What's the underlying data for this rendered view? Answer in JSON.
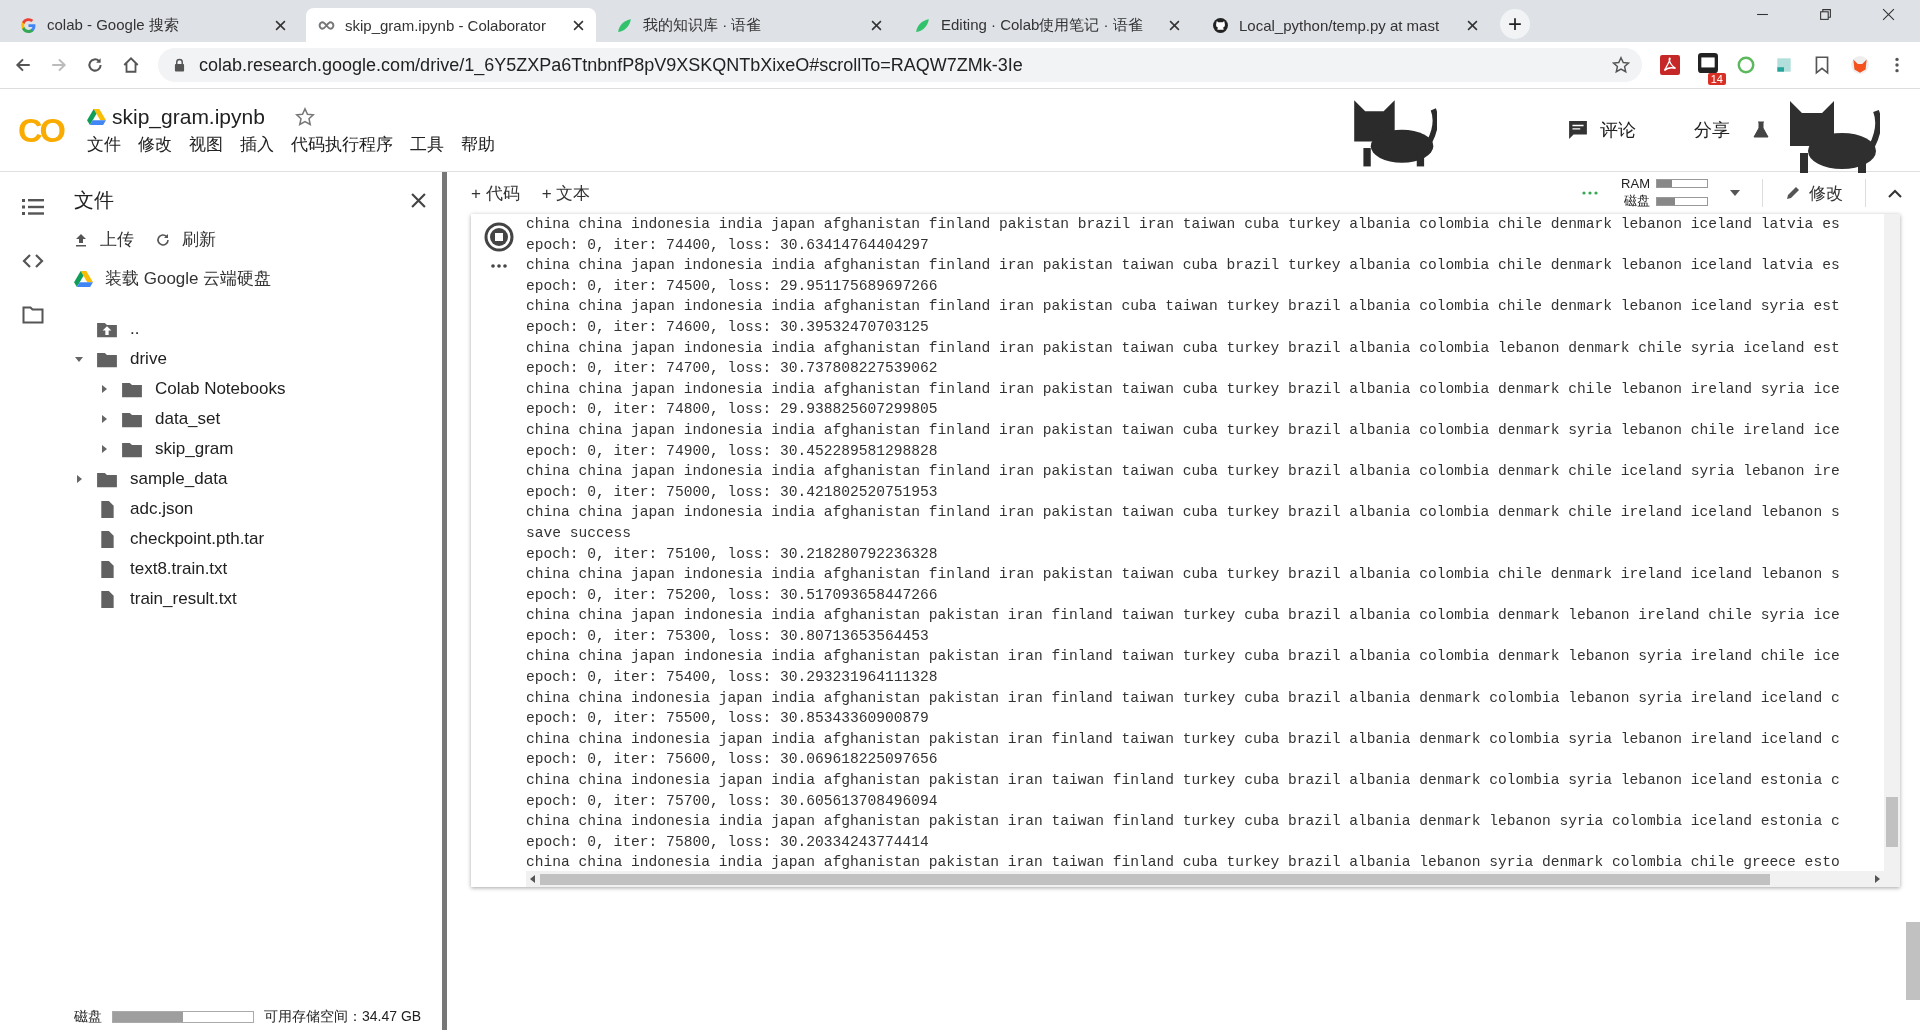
{
  "browser": {
    "tabs": [
      {
        "title": "colab - Google 搜索",
        "selected": false
      },
      {
        "title": "skip_gram.ipynb - Colaborator",
        "selected": true
      },
      {
        "title": "我的知识库 · 语雀",
        "selected": false
      },
      {
        "title": "Editing · Colab使用笔记 · 语雀",
        "selected": false
      },
      {
        "title": "Local_python/temp.py at mast",
        "selected": false
      }
    ],
    "new_tab": "+",
    "url": "colab.research.google.com/drive/1_6Y5ZXPa6TtnbnfP8pV9XSKQNTbXixeO#scrollTo=RAQW7ZMk-3Ie",
    "extension_badge": "14"
  },
  "header": {
    "logo": "CO",
    "notebook_title": "skip_gram.ipynb",
    "menu": [
      "文件",
      "修改",
      "视图",
      "插入",
      "代码执行程序",
      "工具",
      "帮助"
    ],
    "comment": "评论",
    "share": "分享"
  },
  "toolbar": {
    "add_code": "+ 代码",
    "add_text": "+ 文本",
    "ram_label": "RAM",
    "disk_label": "磁盘",
    "ram": {
      "level": 0.3
    },
    "disk": {
      "level": 0.35
    },
    "edit": "修改"
  },
  "sidebar": {
    "title": "文件",
    "upload": "上传",
    "refresh": "刷新",
    "mount": "装载 Google 云端硬盘",
    "tree": [
      {
        "name": "..",
        "kind": "parent"
      },
      {
        "name": "drive",
        "kind": "folder",
        "expanded": true,
        "children": [
          {
            "name": "Colab Notebooks",
            "kind": "folder",
            "expanded": false
          },
          {
            "name": "data_set",
            "kind": "folder",
            "expanded": false
          },
          {
            "name": "skip_gram",
            "kind": "folder",
            "expanded": false
          }
        ]
      },
      {
        "name": "sample_data",
        "kind": "folder",
        "expanded": false
      },
      {
        "name": "adc.json",
        "kind": "file"
      },
      {
        "name": "checkpoint.pth.tar",
        "kind": "file"
      },
      {
        "name": "text8.train.txt",
        "kind": "file"
      },
      {
        "name": "train_result.txt",
        "kind": "file"
      }
    ],
    "disk_label": "磁盘",
    "disk": {
      "level": 0.5
    },
    "free_space": "可用存储空间：34.47 GB"
  },
  "output_lines": [
    "china china indonesia india japan afghanistan finland pakistan brazil iran taiwan cuba turkey albania colombia chile denmark lebanon iceland latvia es",
    "epoch: 0, iter: 74400, loss: 30.63414764404297",
    "china china japan indonesia india afghanistan finland iran pakistan taiwan cuba brazil turkey albania colombia chile denmark lebanon iceland latvia es",
    "epoch: 0, iter: 74500, loss: 29.951175689697266",
    "china china japan indonesia india afghanistan finland iran pakistan cuba taiwan turkey brazil albania colombia chile denmark lebanon iceland syria est",
    "epoch: 0, iter: 74600, loss: 30.39532470703125",
    "china china japan indonesia india afghanistan finland iran pakistan taiwan cuba turkey brazil albania colombia lebanon denmark chile syria iceland est",
    "epoch: 0, iter: 74700, loss: 30.737808227539062",
    "china china japan indonesia india afghanistan finland iran pakistan taiwan cuba turkey brazil albania colombia denmark chile lebanon ireland syria ice",
    "epoch: 0, iter: 74800, loss: 29.938825607299805",
    "china china japan indonesia india afghanistan finland iran pakistan taiwan cuba turkey brazil albania colombia denmark syria lebanon chile ireland ice",
    "epoch: 0, iter: 74900, loss: 30.452289581298828",
    "china china japan indonesia india afghanistan finland iran pakistan taiwan cuba turkey brazil albania colombia denmark chile iceland syria lebanon ire",
    "epoch: 0, iter: 75000, loss: 30.421802520751953",
    "china china japan indonesia india afghanistan finland iran pakistan taiwan cuba turkey brazil albania colombia denmark chile ireland iceland lebanon s",
    "save success",
    "epoch: 0, iter: 75100, loss: 30.218280792236328",
    "china china japan indonesia india afghanistan finland iran pakistan taiwan cuba turkey brazil albania colombia chile denmark ireland iceland lebanon s",
    "epoch: 0, iter: 75200, loss: 30.517093658447266",
    "china china japan indonesia india afghanistan pakistan iran finland taiwan turkey cuba brazil albania colombia denmark lebanon ireland chile syria ice",
    "epoch: 0, iter: 75300, loss: 30.80713653564453",
    "china china japan indonesia india afghanistan pakistan iran finland taiwan turkey cuba brazil albania colombia denmark lebanon syria ireland chile ice",
    "epoch: 0, iter: 75400, loss: 30.293231964111328",
    "china china indonesia japan india afghanistan pakistan iran finland taiwan turkey cuba brazil albania denmark colombia lebanon syria ireland iceland c",
    "epoch: 0, iter: 75500, loss: 30.85343360900879",
    "china china indonesia japan india afghanistan pakistan iran finland taiwan turkey cuba brazil albania denmark colombia syria lebanon ireland iceland c",
    "epoch: 0, iter: 75600, loss: 30.069618225097656",
    "china china indonesia japan india afghanistan pakistan iran taiwan finland turkey cuba brazil albania denmark colombia syria lebanon iceland estonia c",
    "epoch: 0, iter: 75700, loss: 30.605613708496094",
    "china china indonesia india japan afghanistan pakistan iran taiwan finland turkey cuba brazil albania denmark lebanon syria colombia iceland estonia c",
    "epoch: 0, iter: 75800, loss: 30.20334243774414",
    "china china indonesia india japan afghanistan pakistan iran taiwan finland cuba turkey brazil albania lebanon syria denmark colombia chile greece esto"
  ]
}
